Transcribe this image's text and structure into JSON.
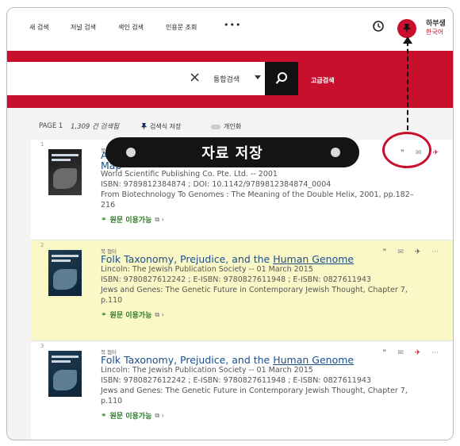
{
  "nav": {
    "items": [
      "새 검색",
      "저널 검색",
      "색인 검색",
      "인용문 조회"
    ],
    "more": "•••",
    "user": "하부생",
    "language": "한국어"
  },
  "search": {
    "clear": "×",
    "scope": "통합검색",
    "advanced": "고급검색"
  },
  "pagebar": {
    "page": "PAGE 1",
    "count": "1,309 건 검색됨",
    "save_search": "검색식 저장",
    "personalize": "개인화"
  },
  "banner": {
    "text": "자료 저장"
  },
  "results": [
    {
      "num": "1",
      "type": "북 챕터",
      "title_a": "Att",
      "title_b": "Map",
      "line1": "World Scientific Publishing Co. Pte. Ltd. -- 2001",
      "line2": "ISBN: 9789812384874 ; DOI: 10.1142/9789812384874_0004",
      "line3": "From Biotechnology To Genomes : The Meaning of the Double Helix, 2001, pp.182–",
      "line4": "216",
      "avail": "원문 이용가능"
    },
    {
      "num": "2",
      "type": "북 챕터",
      "title_a": "Folk Taxonomy, Prejudice, and the ",
      "title_b": "Human Genome",
      "line1": "Lincoln: The Jewish Publication Society -- 01 March 2015",
      "line2": "ISBN: 9780827612242 ; E-ISBN: 9780827611948 ; E-ISBN: 0827611943",
      "line3": "Jews and Genes: The Genetic Future in Contemporary Jewish Thought, Chapter 7,",
      "line4": "p.110",
      "avail": "원문 이용가능"
    },
    {
      "num": "3",
      "type": "북 챕터",
      "title_a": "Folk Taxonomy, Prejudice, and the ",
      "title_b": "Human Genome",
      "line1": "Lincoln: The Jewish Publication Society -- 01 March 2015",
      "line2": "ISBN: 9780827612242 ; E-ISBN: 9780827611948 ; E-ISBN: 0827611943",
      "line3": "Jews and Genes: The Genetic Future in Contemporary Jewish Thought, Chapter 7,",
      "line4": "p.110",
      "avail": "원문 이용가능"
    }
  ],
  "colors": {
    "brand": "#c8102e",
    "highlight": "#fbf8c7",
    "link": "#1a4f8b",
    "available": "#2a7a22"
  }
}
